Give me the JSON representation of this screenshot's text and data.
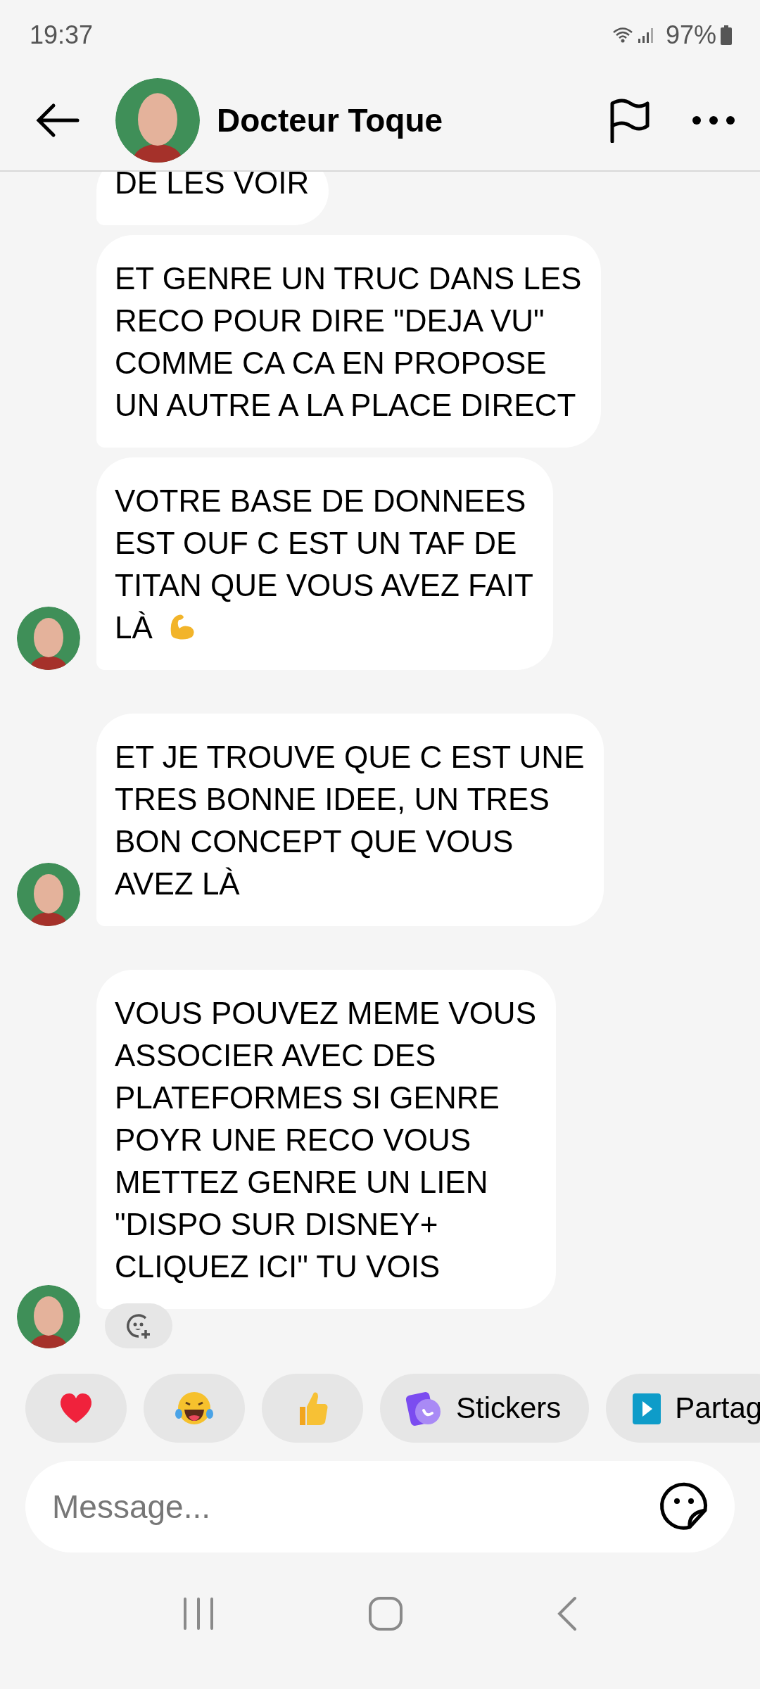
{
  "status_bar": {
    "time": "19:37",
    "battery": "97%"
  },
  "header": {
    "title": "Docteur Toque"
  },
  "messages": [
    {
      "text": "DE LES VOIR",
      "avatar": false,
      "cut_top": true
    },
    {
      "text": "ET GENRE UN TRUC DANS LES\nRECO POUR DIRE \"DEJA VU\"\nCOMME CA CA EN PROPOSE\nUN AUTRE A LA PLACE DIRECT",
      "avatar": false
    },
    {
      "text": "VOTRE BASE DE DONNEES\nEST OUF C EST UN TAF DE\nTITAN QUE VOUS AVEZ FAIT\nLÀ",
      "kind": "text-emoji",
      "avatar": true
    },
    {
      "text": "ET JE TROUVE QUE C EST UNE\nTRES BONNE IDEE, UN TRES\nBON CONCEPT QUE VOUS\nAVEZ LÀ",
      "avatar": true
    },
    {
      "text": "VOUS POUVEZ MEME VOUS\nASSOCIER AVEC DES\nPLATEFORMES SI GENRE\nPOYR UNE RECO VOUS\nMETTEZ GENRE UN LIEN\n\"DISPO SUR DISNEY+\nCLIQUEZ ICI\" TU VOIS",
      "avatar": true,
      "react_button": true
    }
  ],
  "quick_actions": [
    {
      "kind": "heart"
    },
    {
      "kind": "laugh"
    },
    {
      "kind": "thumbs-up"
    },
    {
      "kind": "stickers",
      "label": "Stickers"
    },
    {
      "kind": "share",
      "label": "Partag"
    }
  ],
  "composer": {
    "placeholder": "Message..."
  }
}
